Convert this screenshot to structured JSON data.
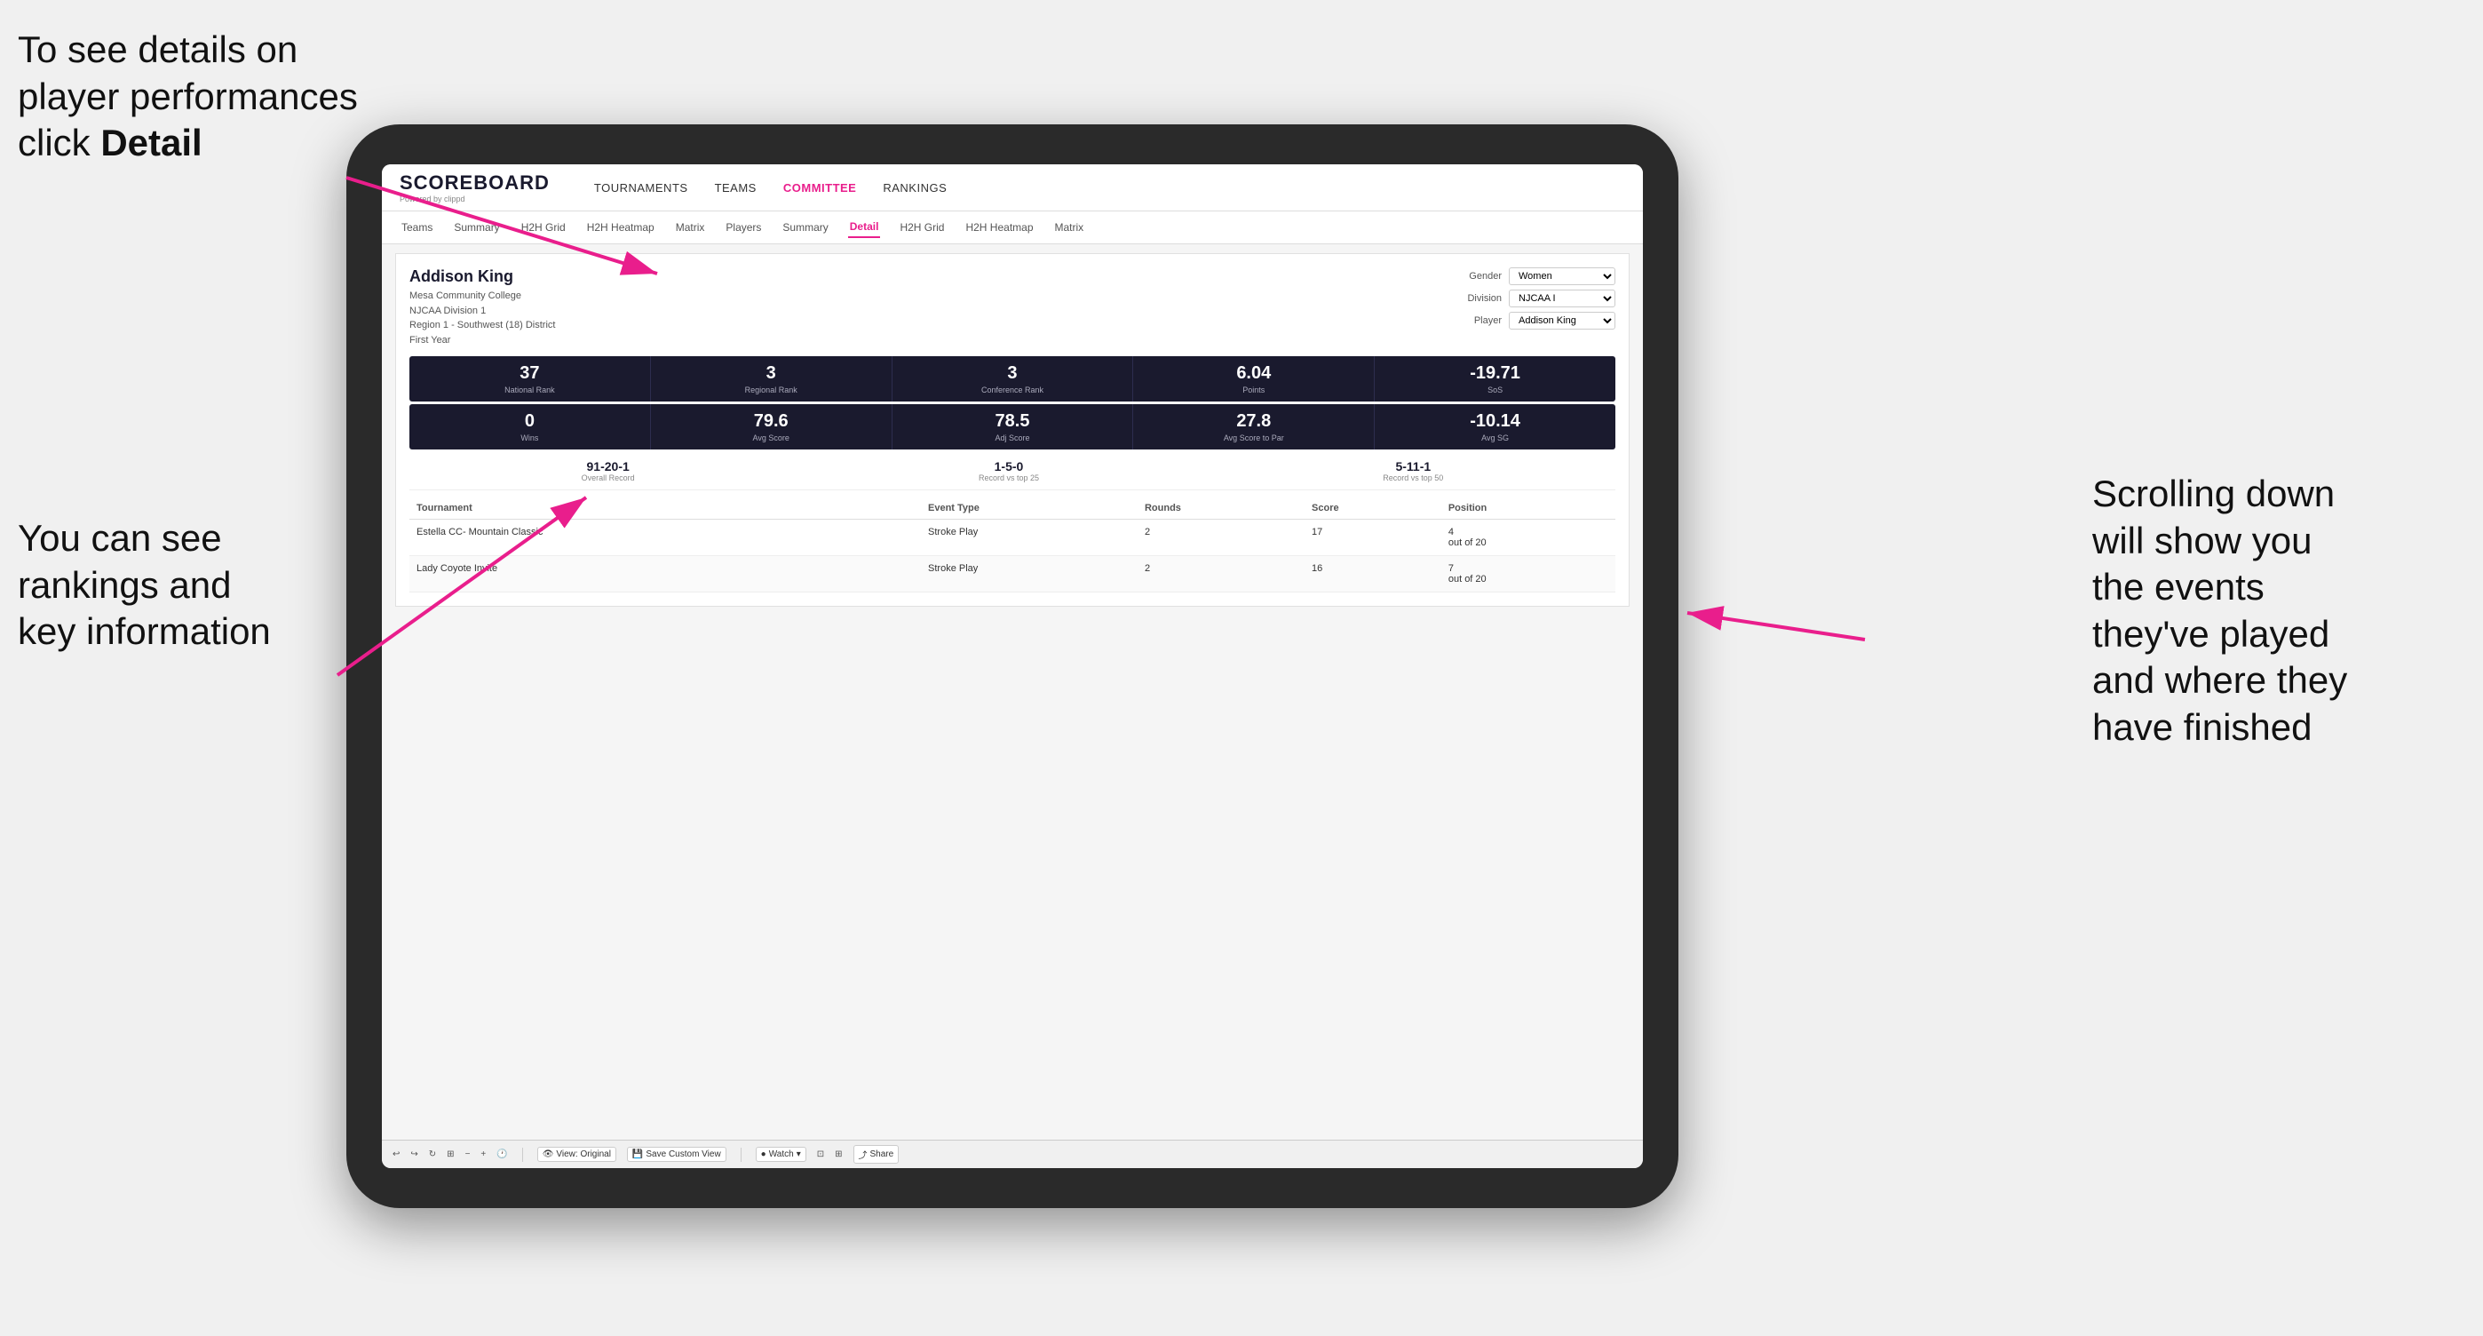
{
  "annotations": {
    "topleft": "To see details on player performances click ",
    "topleft_bold": "Detail",
    "bottomleft_line1": "You can see",
    "bottomleft_line2": "rankings and",
    "bottomleft_line3": "key information",
    "right_line1": "Scrolling down",
    "right_line2": "will show you",
    "right_line3": "the events",
    "right_line4": "they've played",
    "right_line5": "and where they",
    "right_line6": "have finished"
  },
  "nav": {
    "logo": "SCOREBOARD",
    "logo_sub": "Powered by clippd",
    "items": [
      "TOURNAMENTS",
      "TEAMS",
      "COMMITTEE",
      "RANKINGS"
    ],
    "active": "COMMITTEE"
  },
  "subnav": {
    "items": [
      "Teams",
      "Summary",
      "H2H Grid",
      "H2H Heatmap",
      "Matrix",
      "Players",
      "Summary",
      "Detail",
      "H2H Grid",
      "H2H Heatmap",
      "Matrix"
    ],
    "active": "Detail"
  },
  "player": {
    "name": "Addison King",
    "school": "Mesa Community College",
    "division": "NJCAA Division 1",
    "region": "Region 1 - Southwest (18) District",
    "year": "First Year"
  },
  "filters": {
    "gender_label": "Gender",
    "gender_value": "Women",
    "division_label": "Division",
    "division_value": "NJCAA I",
    "player_label": "Player",
    "player_value": "Addison King"
  },
  "stats_row1": [
    {
      "value": "37",
      "label": "National Rank"
    },
    {
      "value": "3",
      "label": "Regional Rank"
    },
    {
      "value": "3",
      "label": "Conference Rank"
    },
    {
      "value": "6.04",
      "label": "Points"
    },
    {
      "value": "-19.71",
      "label": "SoS"
    }
  ],
  "stats_row2": [
    {
      "value": "0",
      "label": "Wins"
    },
    {
      "value": "79.6",
      "label": "Avg Score"
    },
    {
      "value": "78.5",
      "label": "Adj Score"
    },
    {
      "value": "27.8",
      "label": "Avg Score to Par"
    },
    {
      "value": "-10.14",
      "label": "Avg SG"
    }
  ],
  "records": [
    {
      "value": "91-20-1",
      "label": "Overall Record"
    },
    {
      "value": "1-5-0",
      "label": "Record vs top 25"
    },
    {
      "value": "5-11-1",
      "label": "Record vs top 50"
    }
  ],
  "table": {
    "headers": [
      "Tournament",
      "",
      "Event Type",
      "Rounds",
      "Score",
      "Position"
    ],
    "rows": [
      {
        "tournament": "Estella CC- Mountain Classic",
        "event_type": "Stroke Play",
        "rounds": "2",
        "score": "17",
        "position": "4\nout of 20"
      },
      {
        "tournament": "Lady Coyote Invite",
        "event_type": "Stroke Play",
        "rounds": "2",
        "score": "16",
        "position": "7\nout of 20"
      }
    ]
  },
  "toolbar": {
    "view_original": "View: Original",
    "save_custom": "Save Custom View",
    "watch": "Watch",
    "share": "Share"
  }
}
